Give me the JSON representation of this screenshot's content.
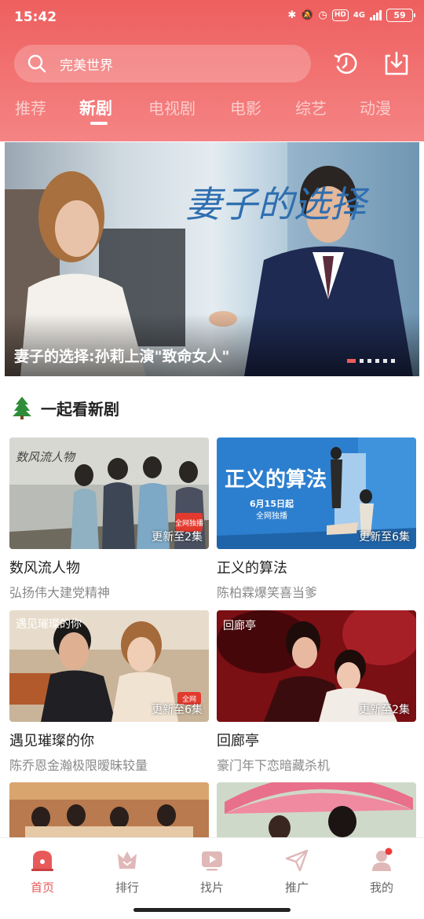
{
  "status_bar": {
    "time": "15:42",
    "network": "4G",
    "hd": "HD",
    "battery": "59"
  },
  "search": {
    "placeholder": "完美世界"
  },
  "tabs": [
    {
      "label": "推荐",
      "active": false
    },
    {
      "label": "新剧",
      "active": true
    },
    {
      "label": "电视剧",
      "active": false
    },
    {
      "label": "电影",
      "active": false
    },
    {
      "label": "综艺",
      "active": false
    },
    {
      "label": "动漫",
      "active": false
    }
  ],
  "banner": {
    "poster_title": "妻子的选择",
    "caption": "妻子的选择:孙莉上演\"致命女人\"",
    "slide_count": 6,
    "active_slide": 1
  },
  "section": {
    "title": "一起看新剧",
    "icon": "tree-icon"
  },
  "cards": [
    {
      "title": "数风流人物",
      "subtitle": "弘扬伟大建党精神",
      "badge": "更新至2集",
      "poster_text": "数风流人物",
      "corner_tag": "全网独播"
    },
    {
      "title": "正义的算法",
      "subtitle": "陈柏霖爆笑喜当爹",
      "badge": "更新至6集",
      "poster_text": "正义的算法",
      "poster_date": "6月15日起",
      "poster_sub": "全网独播"
    },
    {
      "title": "遇见璀璨的你",
      "subtitle": "陈乔恩金瀚极限暧昧较量",
      "badge": "更新至6集",
      "poster_text": "遇见璀璨的你",
      "corner_tag": "全网"
    },
    {
      "title": "回廊亭",
      "subtitle": "豪门年下恋暗藏杀机",
      "badge": "更新至2集",
      "poster_text": "回廊亭"
    }
  ],
  "bottom_nav": [
    {
      "label": "首页",
      "icon": "home-icon",
      "active": true
    },
    {
      "label": "排行",
      "icon": "crown-icon",
      "active": false
    },
    {
      "label": "找片",
      "icon": "tv-icon",
      "active": false
    },
    {
      "label": "推广",
      "icon": "send-icon",
      "active": false
    },
    {
      "label": "我的",
      "icon": "profile-icon",
      "active": false,
      "has_dot": true
    }
  ],
  "colors": {
    "accent": "#e85a5a",
    "header_top": "#ee5f5f",
    "header_bottom": "#f58484"
  }
}
